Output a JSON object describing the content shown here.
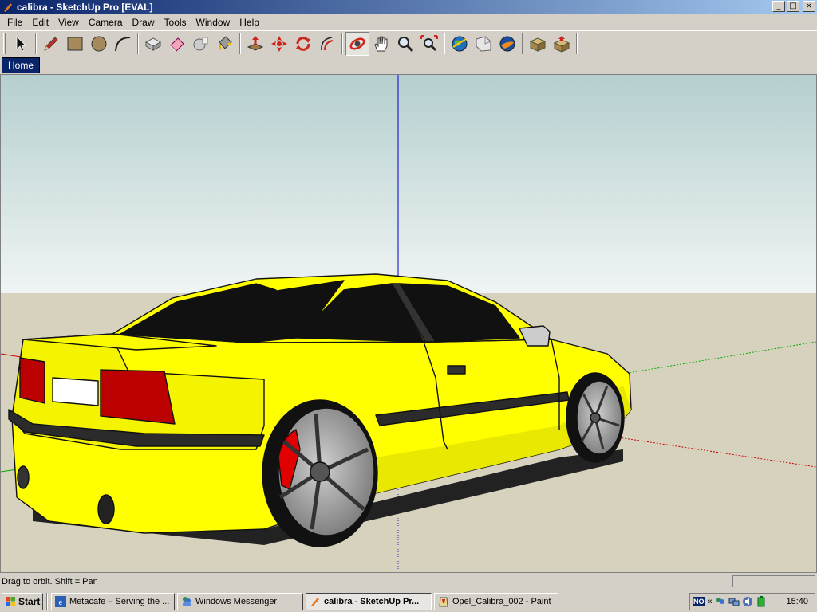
{
  "window": {
    "title": "calibra - SketchUp Pro [EVAL]",
    "minimize": "_",
    "maximize": "□",
    "close": "×"
  },
  "menu": [
    "File",
    "Edit",
    "View",
    "Camera",
    "Draw",
    "Tools",
    "Window",
    "Help"
  ],
  "toolbar": {
    "tools": [
      {
        "name": "select-tool",
        "icon": "arrow-icon"
      },
      {
        "name": "pencil-tool",
        "icon": "pencil-icon"
      },
      {
        "name": "rectangle-tool",
        "icon": "rectangle-icon"
      },
      {
        "name": "circle-tool",
        "icon": "circle-icon"
      },
      {
        "name": "arc-tool",
        "icon": "arc-icon"
      },
      {
        "name": "make-component-tool",
        "icon": "component-icon"
      },
      {
        "name": "eraser-tool",
        "icon": "eraser-icon"
      },
      {
        "name": "tape-measure-tool",
        "icon": "tape-icon"
      },
      {
        "name": "paint-bucket-tool",
        "icon": "paint-bucket-icon"
      },
      {
        "name": "push-pull-tool",
        "icon": "push-pull-icon"
      },
      {
        "name": "move-tool",
        "icon": "move-icon"
      },
      {
        "name": "rotate-tool",
        "icon": "rotate-icon"
      },
      {
        "name": "offset-tool",
        "icon": "offset-icon"
      },
      {
        "name": "orbit-tool",
        "icon": "orbit-icon",
        "pressed": true
      },
      {
        "name": "pan-tool",
        "icon": "hand-icon"
      },
      {
        "name": "zoom-tool",
        "icon": "zoom-icon"
      },
      {
        "name": "zoom-extents-tool",
        "icon": "zoom-extents-icon"
      },
      {
        "name": "get-models-tool",
        "icon": "globe-icon"
      },
      {
        "name": "share-model-tool",
        "icon": "share-icon"
      },
      {
        "name": "google-earth-tool",
        "icon": "earth-icon"
      },
      {
        "name": "components-browser-tool",
        "icon": "components-icon"
      },
      {
        "name": "extension-warehouse-tool",
        "icon": "warehouse-icon"
      }
    ]
  },
  "scene_tabs": [
    "Home"
  ],
  "status": {
    "text": "Drag to orbit.  Shift = Pan",
    "measurements": ""
  },
  "taskbar": {
    "start": "Start",
    "tasks": [
      {
        "label": "Metacafe – Serving the ...",
        "icon": "ie-icon",
        "active": false
      },
      {
        "label": "Windows Messenger",
        "icon": "messenger-icon",
        "active": false
      },
      {
        "label": "calibra - SketchUp Pr...",
        "icon": "sketchup-icon",
        "active": true
      },
      {
        "label": "Opel_Calibra_002 - Paint",
        "icon": "paint-icon",
        "active": false
      }
    ],
    "tray": {
      "language": "NO",
      "expand": "«",
      "clock": "15:40"
    }
  },
  "colors": {
    "sky_top": "#b5cfcf",
    "sky_bottom": "#f0f4f4",
    "ground": "#d7d2be",
    "car_body": "#ffff00",
    "axis_blue": "#0000cc",
    "axis_red": "#cc0000",
    "axis_green": "#00aa00",
    "brake_caliper": "#e00000"
  }
}
